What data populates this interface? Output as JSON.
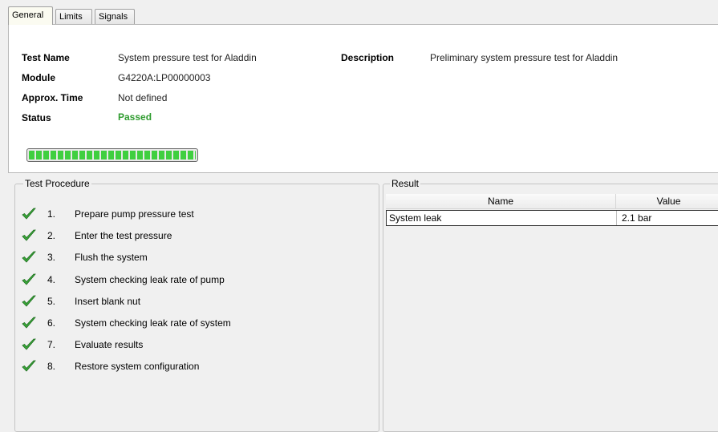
{
  "tabs": [
    {
      "label": "General",
      "active": true
    },
    {
      "label": "Limits",
      "active": false
    },
    {
      "label": "Signals",
      "active": false
    }
  ],
  "general": {
    "test_name_label": "Test Name",
    "test_name_value": "System pressure test for Aladdin",
    "module_label": "Module",
    "module_value": "G4220A:LP00000003",
    "approx_time_label": "Approx. Time",
    "approx_time_value": "Not defined",
    "status_label": "Status",
    "status_value": "Passed",
    "description_label": "Description",
    "description_value": "Preliminary system pressure test for Aladdin",
    "progress_percent": 100,
    "status_color": "#2e9b2e"
  },
  "procedure": {
    "title": "Test Procedure",
    "steps": [
      {
        "num": "1.",
        "label": "Prepare pump pressure test",
        "icon": "check-icon"
      },
      {
        "num": "2.",
        "label": "Enter the test pressure",
        "icon": "check-icon"
      },
      {
        "num": "3.",
        "label": "Flush the system",
        "icon": "check-icon"
      },
      {
        "num": "4.",
        "label": "System checking leak rate of pump",
        "icon": "check-icon"
      },
      {
        "num": "5.",
        "label": "Insert blank nut",
        "icon": "check-icon"
      },
      {
        "num": "6.",
        "label": "System checking leak rate of system",
        "icon": "check-icon"
      },
      {
        "num": "7.",
        "label": "Evaluate results",
        "icon": "check-icon"
      },
      {
        "num": "8.",
        "label": "Restore system configuration",
        "icon": "check-icon"
      }
    ]
  },
  "result": {
    "title": "Result",
    "columns": [
      "Name",
      "Value"
    ],
    "rows": [
      {
        "name": "System leak",
        "value": "2.1 bar"
      }
    ]
  }
}
